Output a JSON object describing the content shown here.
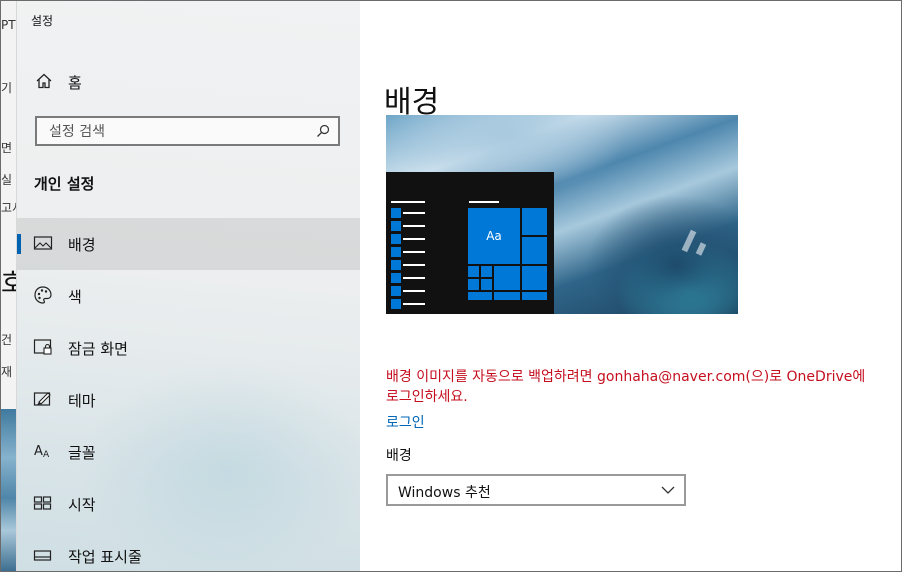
{
  "window": {
    "title": "설정"
  },
  "background_app": {
    "fragments": [
      "PT",
      "기",
      "면",
      "실",
      "고서",
      "호",
      "건",
      "재"
    ]
  },
  "sidebar": {
    "home_label": "홈",
    "search_placeholder": "설정 검색",
    "section_title": "개인 설정",
    "items": [
      {
        "label": "배경",
        "icon": "image-icon",
        "active": true
      },
      {
        "label": "색",
        "icon": "palette-icon",
        "active": false
      },
      {
        "label": "잠금 화면",
        "icon": "lock-screen-icon",
        "active": false
      },
      {
        "label": "테마",
        "icon": "theme-brush-icon",
        "active": false
      },
      {
        "label": "글꼴",
        "icon": "font-icon",
        "active": false
      },
      {
        "label": "시작",
        "icon": "start-layout-icon",
        "active": false
      },
      {
        "label": "작업 표시줄",
        "icon": "taskbar-icon",
        "active": false
      }
    ]
  },
  "main": {
    "title": "배경",
    "preview": {
      "tile_label": "Aa"
    },
    "notice_text": "배경 이미지를 자동으로 백업하려면 gonhaha@naver.com(으)로 OneDrive에 로그인하세요.",
    "login_link": "로그인",
    "background_label": "배경",
    "background_select_value": "Windows 추천"
  },
  "colors": {
    "accent": "#0078d7",
    "link": "#0067b8",
    "warning": "#c50f1f"
  }
}
